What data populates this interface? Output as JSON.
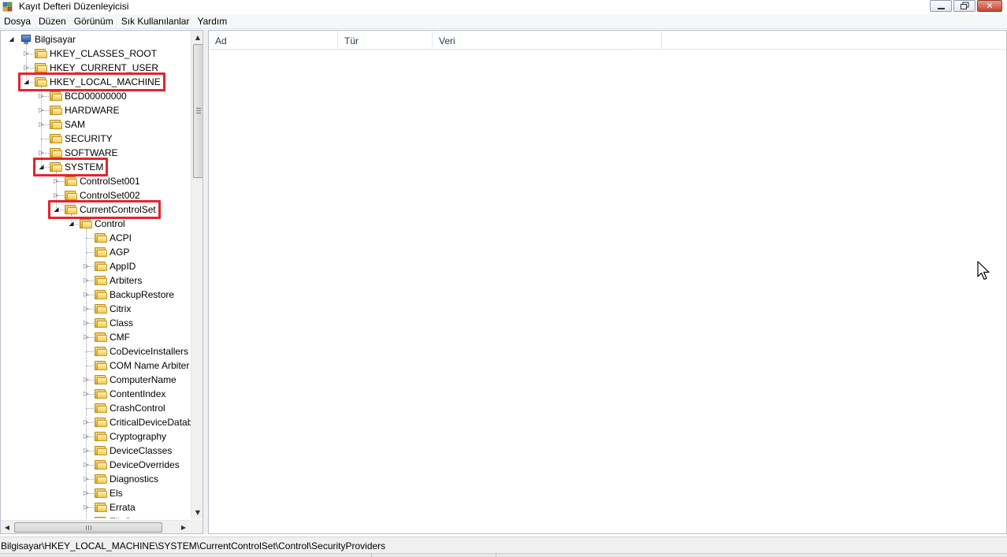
{
  "window": {
    "title": "Kayıt Defteri Düzenleyicisi",
    "minimize_icon": "minimize-icon",
    "restore_icon": "restore-icon",
    "close_icon": "close-icon"
  },
  "menu": {
    "items": [
      "Dosya",
      "Düzen",
      "Görünüm",
      "Sık Kullanılanlar",
      "Yardım"
    ]
  },
  "tree": {
    "root": "Bilgisayar",
    "nodes": [
      {
        "label": "Bilgisayar",
        "depth": 0,
        "state": "expanded",
        "icon": "computer-icon"
      },
      {
        "label": "HKEY_CLASSES_ROOT",
        "depth": 1,
        "state": "collapsed",
        "icon": "folder-icon"
      },
      {
        "label": "HKEY_CURRENT_USER",
        "depth": 1,
        "state": "collapsed",
        "icon": "folder-icon"
      },
      {
        "label": "HKEY_LOCAL_MACHINE",
        "depth": 1,
        "state": "expanded",
        "icon": "folder-icon",
        "highlighted": true
      },
      {
        "label": "BCD00000000",
        "depth": 2,
        "state": "collapsed",
        "icon": "folder-icon"
      },
      {
        "label": "HARDWARE",
        "depth": 2,
        "state": "collapsed",
        "icon": "folder-icon"
      },
      {
        "label": "SAM",
        "depth": 2,
        "state": "collapsed",
        "icon": "folder-icon"
      },
      {
        "label": "SECURITY",
        "depth": 2,
        "state": "leaf",
        "icon": "folder-icon"
      },
      {
        "label": "SOFTWARE",
        "depth": 2,
        "state": "collapsed",
        "icon": "folder-icon"
      },
      {
        "label": "SYSTEM",
        "depth": 2,
        "state": "expanded",
        "icon": "folder-icon",
        "highlighted": true
      },
      {
        "label": "ControlSet001",
        "depth": 3,
        "state": "collapsed",
        "icon": "folder-icon"
      },
      {
        "label": "ControlSet002",
        "depth": 3,
        "state": "collapsed",
        "icon": "folder-icon"
      },
      {
        "label": "CurrentControlSet",
        "depth": 3,
        "state": "expanded",
        "icon": "folder-icon",
        "highlighted": true
      },
      {
        "label": "Control",
        "depth": 4,
        "state": "expanded",
        "icon": "folder-icon"
      },
      {
        "label": "ACPI",
        "depth": 5,
        "state": "leaf",
        "icon": "folder-icon"
      },
      {
        "label": "AGP",
        "depth": 5,
        "state": "leaf",
        "icon": "folder-icon"
      },
      {
        "label": "AppID",
        "depth": 5,
        "state": "collapsed",
        "icon": "folder-icon"
      },
      {
        "label": "Arbiters",
        "depth": 5,
        "state": "collapsed",
        "icon": "folder-icon"
      },
      {
        "label": "BackupRestore",
        "depth": 5,
        "state": "collapsed",
        "icon": "folder-icon"
      },
      {
        "label": "Citrix",
        "depth": 5,
        "state": "collapsed",
        "icon": "folder-icon"
      },
      {
        "label": "Class",
        "depth": 5,
        "state": "collapsed",
        "icon": "folder-icon"
      },
      {
        "label": "CMF",
        "depth": 5,
        "state": "collapsed",
        "icon": "folder-icon"
      },
      {
        "label": "CoDeviceInstallers",
        "depth": 5,
        "state": "leaf",
        "icon": "folder-icon"
      },
      {
        "label": "COM Name Arbiter",
        "depth": 5,
        "state": "leaf",
        "icon": "folder-icon"
      },
      {
        "label": "ComputerName",
        "depth": 5,
        "state": "collapsed",
        "icon": "folder-icon"
      },
      {
        "label": "ContentIndex",
        "depth": 5,
        "state": "collapsed",
        "icon": "folder-icon"
      },
      {
        "label": "CrashControl",
        "depth": 5,
        "state": "leaf",
        "icon": "folder-icon"
      },
      {
        "label": "CriticalDeviceDatab",
        "depth": 5,
        "state": "collapsed",
        "icon": "folder-icon"
      },
      {
        "label": "Cryptography",
        "depth": 5,
        "state": "collapsed",
        "icon": "folder-icon"
      },
      {
        "label": "DeviceClasses",
        "depth": 5,
        "state": "collapsed",
        "icon": "folder-icon"
      },
      {
        "label": "DeviceOverrides",
        "depth": 5,
        "state": "collapsed",
        "icon": "folder-icon"
      },
      {
        "label": "Diagnostics",
        "depth": 5,
        "state": "collapsed",
        "icon": "folder-icon"
      },
      {
        "label": "Els",
        "depth": 5,
        "state": "collapsed",
        "icon": "folder-icon"
      },
      {
        "label": "Errata",
        "depth": 5,
        "state": "collapsed",
        "icon": "folder-icon"
      },
      {
        "label": "FileSystem",
        "depth": 5,
        "state": "collapsed",
        "icon": "folder-icon"
      }
    ]
  },
  "list": {
    "columns": [
      "Ad",
      "Tür",
      "Veri"
    ]
  },
  "status": {
    "path": "Bilgisayar\\HKEY_LOCAL_MACHINE\\SYSTEM\\CurrentControlSet\\Control\\SecurityProviders"
  },
  "colors": {
    "highlight": "#e8232e",
    "header_text": "#1e395b"
  }
}
